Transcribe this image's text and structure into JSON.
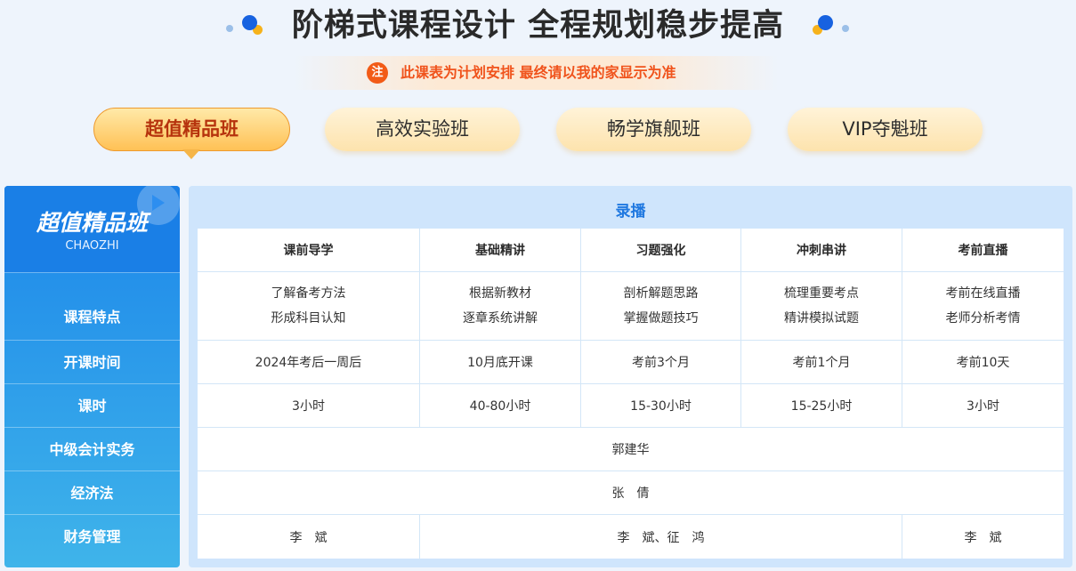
{
  "header": {
    "title": "阶梯式课程设计 全程规划稳步提高",
    "notice_icon": "注",
    "notice_text": "此课表为计划安排 最终请以我的家显示为准"
  },
  "tabs": [
    {
      "label": "超值精品班",
      "active": true
    },
    {
      "label": "高效实验班",
      "active": false
    },
    {
      "label": "畅学旗舰班",
      "active": false
    },
    {
      "label": "VIP夺魁班",
      "active": false
    }
  ],
  "left_panel": {
    "title": "超值精品班",
    "subtitle": "CHAOZHI",
    "rows": [
      "课程特点",
      "开课时间",
      "课时",
      "中级会计实务",
      "经济法",
      "财务管理"
    ]
  },
  "table": {
    "section_title": "录播",
    "columns": [
      "课前导学",
      "基础精讲",
      "习题强化",
      "冲刺串讲",
      "考前直播"
    ],
    "features": [
      [
        "了解备考方法",
        "形成科目认知"
      ],
      [
        "根据新教材",
        "逐章系统讲解"
      ],
      [
        "剖析解题思路",
        "掌握做题技巧"
      ],
      [
        "梳理重要考点",
        "精讲模拟试题"
      ],
      [
        "考前在线直播",
        "老师分析考情"
      ]
    ],
    "start_times": [
      "2024年考后一周后",
      "10月底开课",
      "考前3个月",
      "考前1个月",
      "考前10天"
    ],
    "hours": [
      "3小时",
      "40-80小时",
      "15-30小时",
      "15-25小时",
      "3小时"
    ],
    "teacher_zhongji": "郭建华",
    "teacher_jingjifa": "张　倩",
    "teacher_caiwu": [
      "李　斌",
      "李　斌、征　鸿",
      "李　斌"
    ]
  },
  "colors": {
    "accent_blue": "#1a7fe6",
    "notice_orange": "#f0531c",
    "tab_active_text": "#b6330d"
  }
}
